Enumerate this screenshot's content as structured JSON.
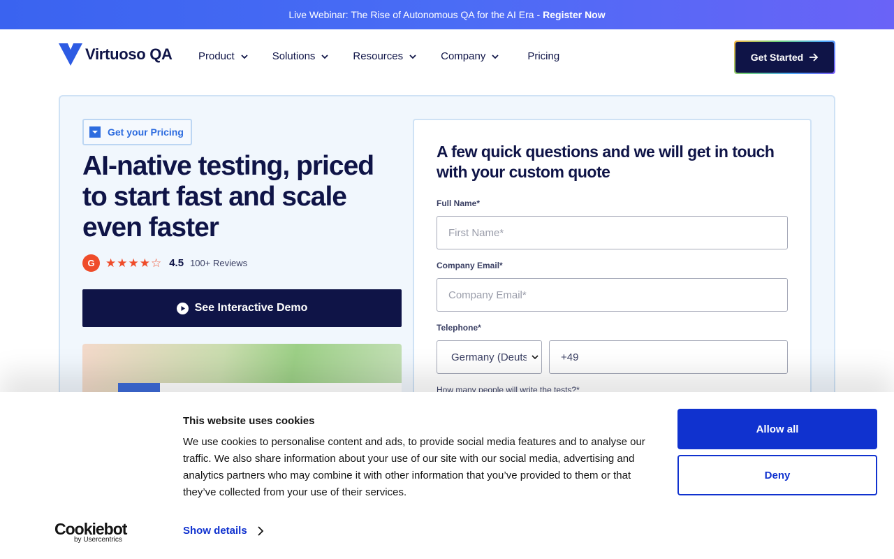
{
  "banner": {
    "text": "Live Webinar: The Rise of Autonomous QA for the AI Era -",
    "link": "Register Now"
  },
  "nav": {
    "logo_text": "Virtuoso QA",
    "items": [
      {
        "label": "Product"
      },
      {
        "label": "Solutions"
      },
      {
        "label": "Resources"
      },
      {
        "label": "Company"
      }
    ],
    "pricing": "Pricing",
    "cta": "Get Started"
  },
  "hero": {
    "pill": "Get your Pricing",
    "headline": "AI-native testing, priced to start fast and scale even faster",
    "g2_mark": "G",
    "stars": "★★★★☆",
    "score": "4.5",
    "reviews": "100+ Reviews",
    "demo_button": "See Interactive Demo"
  },
  "form": {
    "title": "A few quick questions and we will get in touch with your custom quote",
    "full_name_label": "Full Name*",
    "first_name_placeholder": "First Name*",
    "email_label": "Company Email*",
    "email_placeholder": "Company Email*",
    "phone_label": "Telephone*",
    "country_selected": "Germany (Deutschland)",
    "phone_value": "+49",
    "writers_label": "How many people will write the tests?*"
  },
  "cookie": {
    "title": "This website uses cookies",
    "body": "We use cookies to personalise content and ads, to provide social media features and to analyse our traffic. We also share information about your use of our site with our social media, advertising and analytics partners who may combine it with other information that you’ve provided to them or that they’ve collected from your use of their services.",
    "details": "Show details",
    "allow": "Allow all",
    "deny": "Deny",
    "logo_big": "Cookiebot",
    "logo_small": "by Usercentrics"
  },
  "colors": {
    "navy": "#0f1447",
    "accent_blue": "#1032cf",
    "g2_red": "#ef4c2a",
    "hero_bg": "#f1f7fd"
  },
  "icons": [
    "virtuoso-logo-icon",
    "chevron-down-icon",
    "arrow-right-icon",
    "play-icon",
    "g2-icon",
    "chevron-right-icon"
  ]
}
